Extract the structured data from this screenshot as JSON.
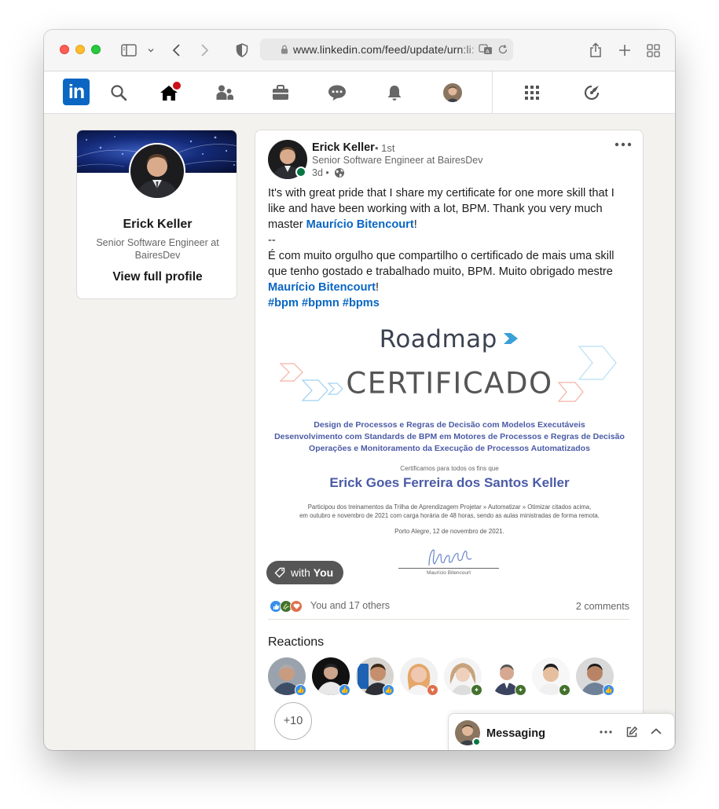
{
  "browser": {
    "url": "www.linkedin.com/feed/update/urn:li:"
  },
  "nav": {
    "logo_text": "in",
    "notification_count": "1"
  },
  "profile": {
    "name": "Erick Keller",
    "headline": "Senior Software Engineer at BairesDev",
    "view_full_profile": "View full profile"
  },
  "post": {
    "author": "Erick Keller",
    "degree": "• 1st",
    "headline": "Senior Software Engineer at BairesDev",
    "time": "3d •",
    "text_en": "It's with great pride that I share my certificate for one more skill that I like and have been working with a lot, BPM. Thank you very much master",
    "mention_1": "Maurício Bitencourt",
    "punct_1": "!",
    "separator": "--",
    "text_pt": "É com muito orgulho que compartilho o certificado de mais uma skill que tenho gostado e trabalhado muito, BPM. Muito obrigado mestre",
    "mention_2": "Maurício Bitencourt",
    "punct_2": "!",
    "hashtags": "#bpm #bpmn #bpms",
    "tag_label_prefix": "with",
    "tag_label_name": "You",
    "reactions_summary": "You and 17 others",
    "comments": "2 comments",
    "reactions_heading": "Reactions",
    "more_reactors": "+10"
  },
  "certificate": {
    "brand": "Roadmap",
    "title": "CERTIFICADO",
    "course_1": "Design de Processos e Regras de Decisão com Modelos Executáveis",
    "course_2": "Desenvolvimento com Standards de BPM em Motores de Processos e Regras de Decisão",
    "course_3": "Operações e Monitoramento da Execução de Processos Automatizados",
    "certify_line": "Certificamos para todos os fins que",
    "recipient": "Erick Goes Ferreira dos Santos Keller",
    "body_1": "Participou dos treinamentos da Trilha de Aprendizagem Projetar » Automatizar » Otimizar citados acima,",
    "body_2": "em outubro e novembro de 2021 com carga horária de 48 horas, sendo as aulas ministradas de forma remota.",
    "place_date": "Porto Alegre, 12 de novembro de 2021.",
    "signatory": "Maurício Bitencourt"
  },
  "messaging": {
    "label": "Messaging"
  },
  "colors": {
    "linkedin_blue": "#0a66c2",
    "cert_blue": "#4a5ba6",
    "online_green": "#057642",
    "notification_red": "#cc1016"
  }
}
